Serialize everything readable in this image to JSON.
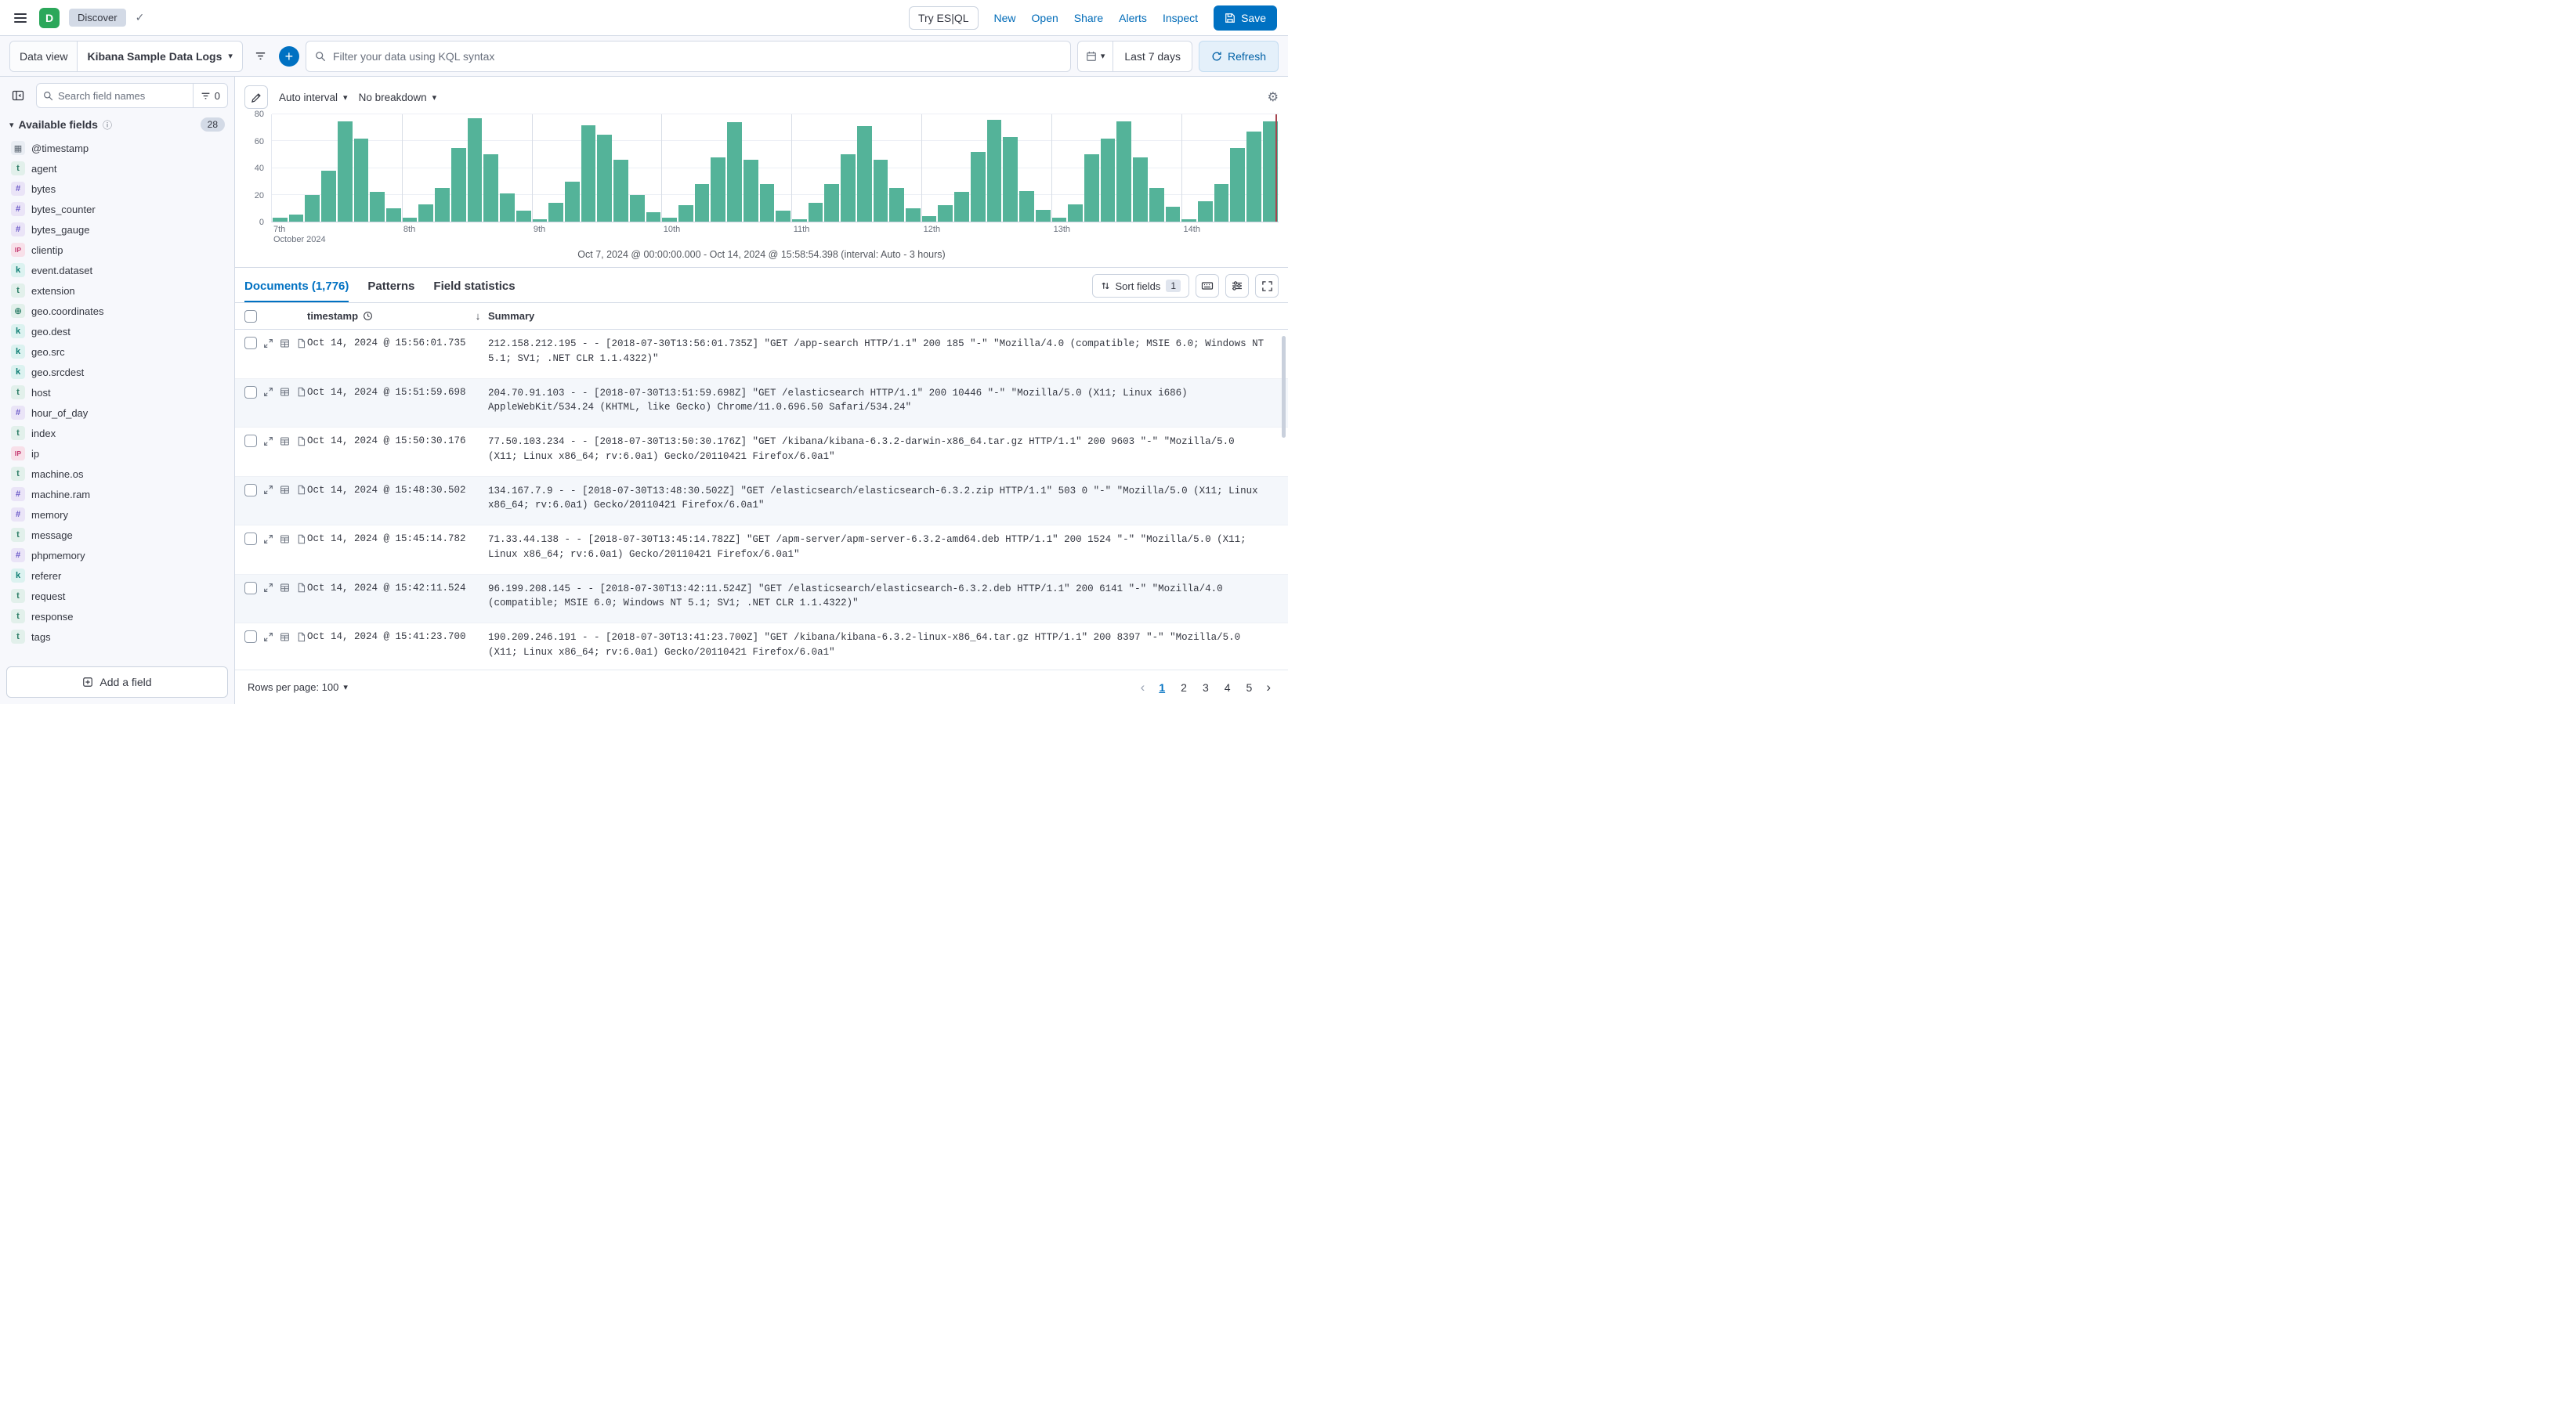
{
  "colors": {
    "primary": "#0071C2",
    "histogram_bar": "#54B399",
    "link": "#006BB8",
    "time_marker": "#A6444E"
  },
  "header": {
    "space_initial": "D",
    "breadcrumb": "Discover",
    "try_esql": "Try ES|QL",
    "nav": [
      "New",
      "Open",
      "Share",
      "Alerts",
      "Inspect"
    ],
    "save_label": "Save"
  },
  "toolbar": {
    "data_view_label": "Data view",
    "data_view_value": "Kibana Sample Data Logs",
    "search_placeholder": "Filter your data using KQL syntax",
    "time_range": "Last 7 days",
    "refresh_label": "Refresh"
  },
  "sidebar": {
    "search_placeholder": "Search field names",
    "filter_count": "0",
    "section_title": "Available fields",
    "field_count": "28",
    "add_field_label": "Add a field",
    "fields": [
      {
        "name": "@timestamp",
        "type": "date"
      },
      {
        "name": "agent",
        "type": "text"
      },
      {
        "name": "bytes",
        "type": "number"
      },
      {
        "name": "bytes_counter",
        "type": "number"
      },
      {
        "name": "bytes_gauge",
        "type": "number"
      },
      {
        "name": "clientip",
        "type": "ip"
      },
      {
        "name": "event.dataset",
        "type": "keyword"
      },
      {
        "name": "extension",
        "type": "text"
      },
      {
        "name": "geo.coordinates",
        "type": "geo_point"
      },
      {
        "name": "geo.dest",
        "type": "keyword"
      },
      {
        "name": "geo.src",
        "type": "keyword"
      },
      {
        "name": "geo.srcdest",
        "type": "keyword"
      },
      {
        "name": "host",
        "type": "text"
      },
      {
        "name": "hour_of_day",
        "type": "number"
      },
      {
        "name": "index",
        "type": "text"
      },
      {
        "name": "ip",
        "type": "ip"
      },
      {
        "name": "machine.os",
        "type": "text"
      },
      {
        "name": "machine.ram",
        "type": "number"
      },
      {
        "name": "memory",
        "type": "number"
      },
      {
        "name": "message",
        "type": "text"
      },
      {
        "name": "phpmemory",
        "type": "number"
      },
      {
        "name": "referer",
        "type": "keyword"
      },
      {
        "name": "request",
        "type": "text"
      },
      {
        "name": "response",
        "type": "text"
      },
      {
        "name": "tags",
        "type": "text"
      }
    ]
  },
  "chart": {
    "interval_label": "Auto interval",
    "breakdown_label": "No breakdown",
    "caption": "Oct 7, 2024 @ 00:00:00.000 - Oct 14, 2024 @ 15:58:54.398 (interval: Auto - 3 hours)"
  },
  "chart_data": {
    "type": "bar",
    "title": "",
    "xlabel": "",
    "ylabel": "",
    "ylim": [
      0,
      80
    ],
    "yticks": [
      0,
      20,
      40,
      60,
      80
    ],
    "x_day_labels": [
      "7th",
      "8th",
      "9th",
      "10th",
      "11th",
      "12th",
      "13th",
      "14th"
    ],
    "x_sub_label": "October 2024",
    "day_tick_indices": [
      0,
      8,
      16,
      24,
      32,
      40,
      48,
      56
    ],
    "interval_hours": 3,
    "bar_color": "#54B399",
    "values": [
      3,
      5,
      20,
      38,
      75,
      62,
      22,
      10,
      3,
      13,
      25,
      55,
      77,
      50,
      21,
      8,
      2,
      14,
      30,
      72,
      65,
      46,
      20,
      7,
      3,
      12,
      28,
      48,
      74,
      46,
      28,
      8,
      2,
      14,
      28,
      50,
      71,
      46,
      25,
      10,
      4,
      12,
      22,
      52,
      76,
      63,
      23,
      9,
      3,
      13,
      50,
      62,
      75,
      48,
      25,
      11,
      2,
      15,
      28,
      55,
      67,
      75
    ]
  },
  "documents": {
    "tabs": [
      {
        "id": "documents",
        "label": "Documents (1,776)",
        "active": true
      },
      {
        "id": "patterns",
        "label": "Patterns",
        "active": false
      },
      {
        "id": "field-statistics",
        "label": "Field statistics",
        "active": false
      }
    ],
    "sort_fields_label": "Sort fields",
    "sort_fields_count": "1",
    "columns": {
      "timestamp": "timestamp",
      "summary": "Summary"
    },
    "rows": [
      {
        "timestamp": "Oct 14, 2024 @ 15:56:01.735",
        "summary": "212.158.212.195 - - [2018-07-30T13:56:01.735Z] \"GET /app-search HTTP/1.1\" 200 185 \"-\" \"Mozilla/4.0 (compatible; MSIE 6.0; Windows NT 5.1; SV1; .NET CLR 1.1.4322)\""
      },
      {
        "timestamp": "Oct 14, 2024 @ 15:51:59.698",
        "summary": "204.70.91.103 - - [2018-07-30T13:51:59.698Z] \"GET /elasticsearch HTTP/1.1\" 200 10446 \"-\" \"Mozilla/5.0 (X11; Linux i686) AppleWebKit/534.24 (KHTML, like Gecko) Chrome/11.0.696.50 Safari/534.24\""
      },
      {
        "timestamp": "Oct 14, 2024 @ 15:50:30.176",
        "summary": "77.50.103.234 - - [2018-07-30T13:50:30.176Z] \"GET /kibana/kibana-6.3.2-darwin-x86_64.tar.gz HTTP/1.1\" 200 9603 \"-\" \"Mozilla/5.0 (X11; Linux x86_64; rv:6.0a1) Gecko/20110421 Firefox/6.0a1\""
      },
      {
        "timestamp": "Oct 14, 2024 @ 15:48:30.502",
        "summary": "134.167.7.9 - - [2018-07-30T13:48:30.502Z] \"GET /elasticsearch/elasticsearch-6.3.2.zip HTTP/1.1\" 503 0 \"-\" \"Mozilla/5.0 (X11; Linux x86_64; rv:6.0a1) Gecko/20110421 Firefox/6.0a1\""
      },
      {
        "timestamp": "Oct 14, 2024 @ 15:45:14.782",
        "summary": "71.33.44.138 - - [2018-07-30T13:45:14.782Z] \"GET /apm-server/apm-server-6.3.2-amd64.deb HTTP/1.1\" 200 1524 \"-\" \"Mozilla/5.0 (X11; Linux x86_64; rv:6.0a1) Gecko/20110421 Firefox/6.0a1\""
      },
      {
        "timestamp": "Oct 14, 2024 @ 15:42:11.524",
        "summary": "96.199.208.145 - - [2018-07-30T13:42:11.524Z] \"GET /elasticsearch/elasticsearch-6.3.2.deb HTTP/1.1\" 200 6141 \"-\" \"Mozilla/4.0 (compatible; MSIE 6.0; Windows NT 5.1; SV1; .NET CLR 1.1.4322)\""
      },
      {
        "timestamp": "Oct 14, 2024 @ 15:41:23.700",
        "summary": "190.209.246.191 - - [2018-07-30T13:41:23.700Z] \"GET /kibana/kibana-6.3.2-linux-x86_64.tar.gz HTTP/1.1\" 200 8397 \"-\" \"Mozilla/5.0 (X11; Linux x86_64; rv:6.0a1) Gecko/20110421 Firefox/6.0a1\""
      }
    ]
  },
  "footer": {
    "rows_per_page_label": "Rows per page: 100",
    "pages": [
      "1",
      "2",
      "3",
      "4",
      "5"
    ],
    "active_page": "1"
  }
}
